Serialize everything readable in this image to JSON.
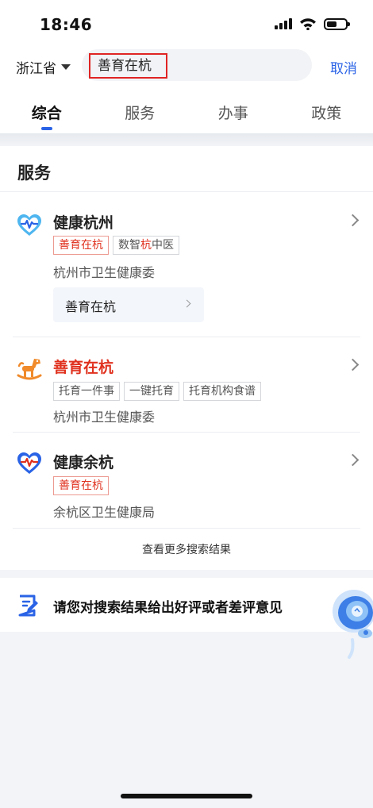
{
  "status": {
    "time": "18:46"
  },
  "header": {
    "region": "浙江省",
    "search_value": "善育在杭",
    "cancel_label": "取消"
  },
  "tabs": [
    {
      "label": "综合",
      "active": true
    },
    {
      "label": "服务",
      "active": false
    },
    {
      "label": "办事",
      "active": false
    },
    {
      "label": "政策",
      "active": false
    }
  ],
  "section": {
    "title": "服务"
  },
  "results": [
    {
      "name": "健康杭州",
      "tag1": "善育在杭",
      "tag2_pre": "数智",
      "tag2_hl": "杭",
      "tag2_post": "中医",
      "org": "杭州市卫生健康委",
      "sub_service": "善育在杭"
    },
    {
      "name": "善育在杭",
      "tags": [
        "托育一件事",
        "一键托育",
        "托育机构食谱"
      ],
      "org": "杭州市卫生健康委"
    },
    {
      "name": "健康余杭",
      "tags": [
        "善育在杭"
      ],
      "org": "余杭区卫生健康局"
    }
  ],
  "more_results_label": "查看更多搜索结果",
  "feedback": {
    "text": "请您对搜索结果给出好评或者差评意见"
  },
  "colors": {
    "accent": "#2a63e6",
    "highlight": "#e0321f"
  }
}
